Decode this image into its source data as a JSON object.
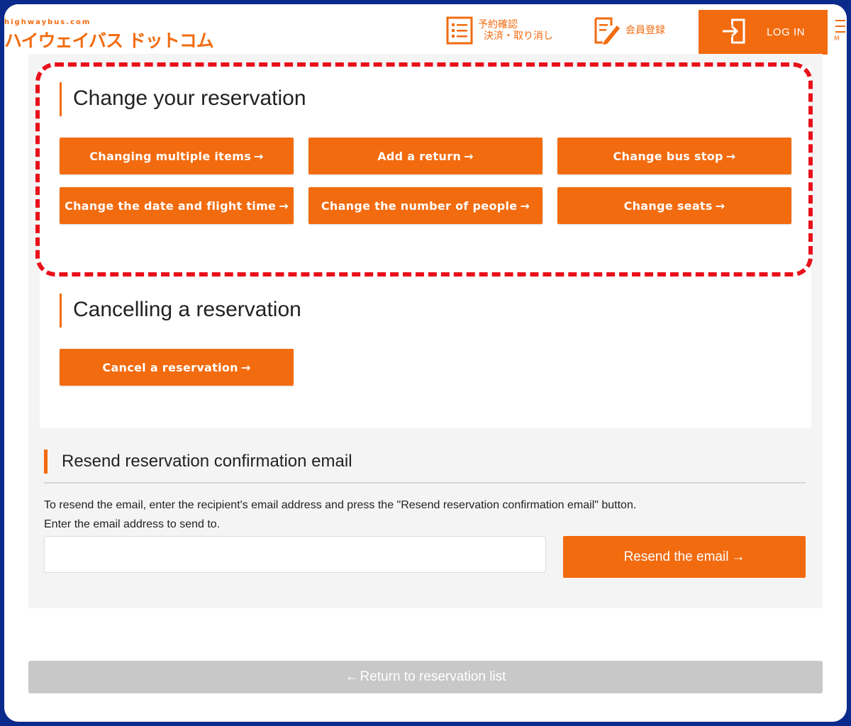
{
  "header": {
    "logo_sub": "highwaybus.com",
    "logo_main": "ハイウェイバス ドットコム",
    "reservation_check_line1": "予約確認",
    "reservation_check_line2": "決済・取り消し",
    "member_register": "会員登録",
    "login": "LOG IN",
    "menu_label": "M",
    "accent_color": "#f26b0f"
  },
  "change_section": {
    "title": "Change your reservation",
    "buttons": [
      "Changing multiple items",
      "Add a return",
      "Change bus stop",
      "Change the date and flight time",
      "Change the number of people",
      "Change seats"
    ]
  },
  "cancel_section": {
    "title": "Cancelling a reservation",
    "button": "Cancel a reservation"
  },
  "resend_section": {
    "title": "Resend reservation confirmation email",
    "description": "To resend the email, enter the recipient's email address and press the \"Resend reservation confirmation email\" button.",
    "field_label": "Enter the email address to send to.",
    "email_value": "",
    "button": "Resend the email"
  },
  "footer": {
    "return_link": "Return to reservation list"
  },
  "highlight_color": "#e8101a"
}
